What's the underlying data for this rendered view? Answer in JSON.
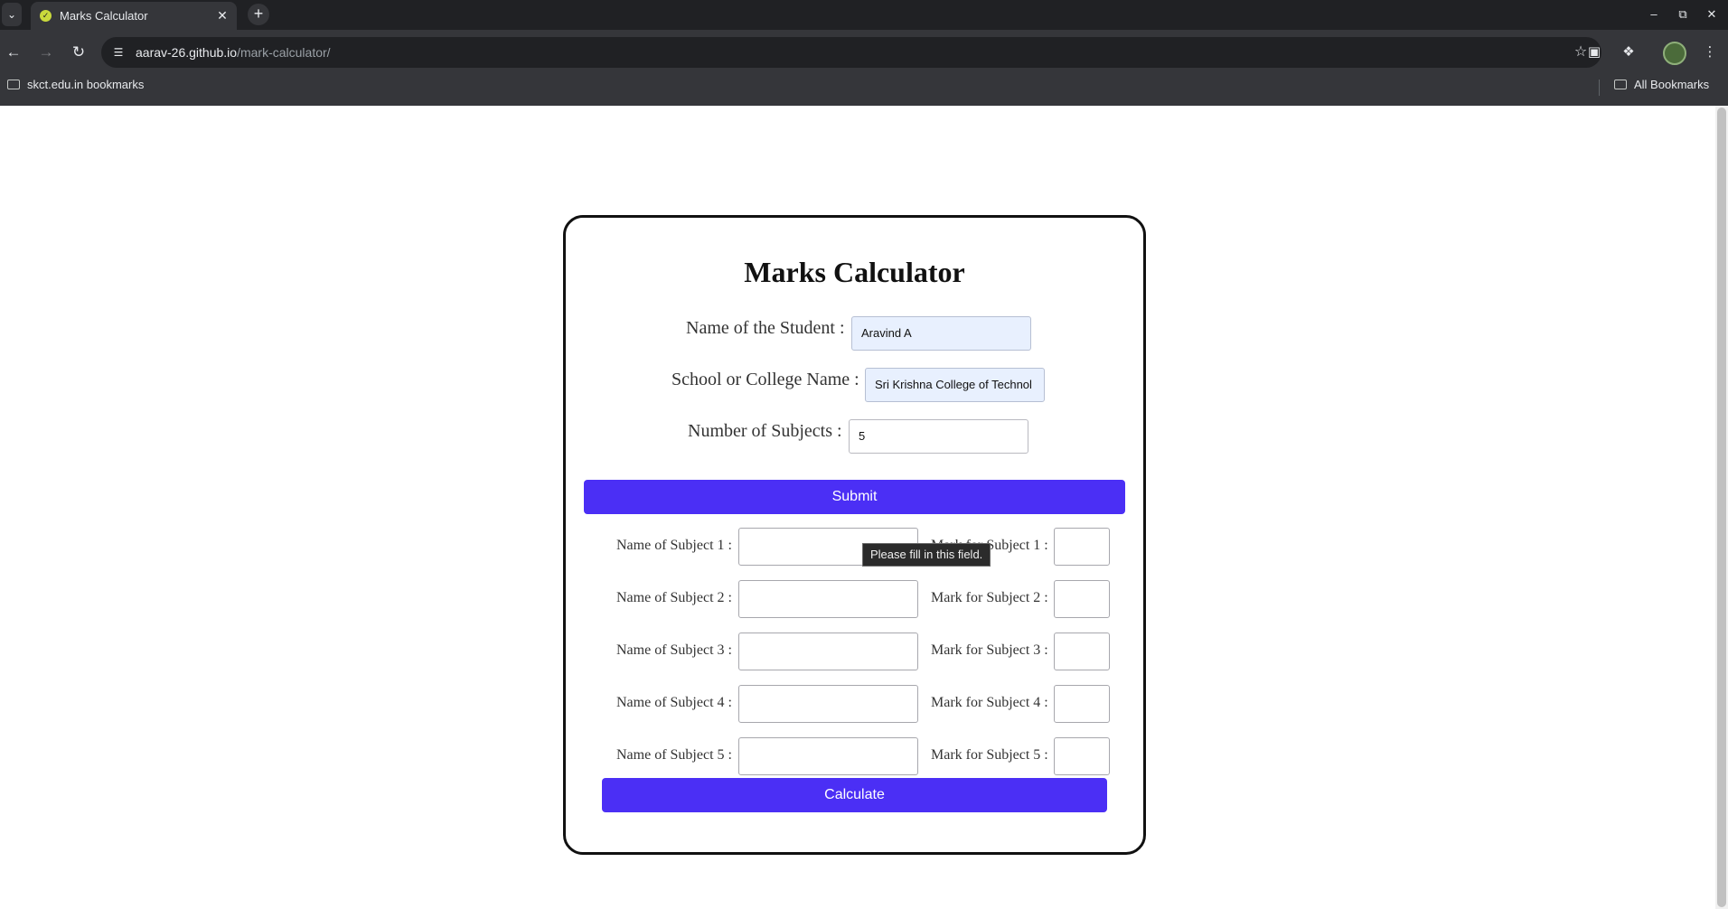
{
  "browser": {
    "tab_title": "Marks Calculator",
    "url_host": "aarav-26.github.io",
    "url_path": "/mark-calculator/",
    "bookmarks": [
      {
        "label": "skct.edu.in bookmarks"
      },
      {
        "label": "All Bookmarks"
      }
    ],
    "icons": [
      "tab-list-icon",
      "close-icon",
      "plus-icon",
      "minimize-icon",
      "restore-icon",
      "back-icon",
      "forward-icon",
      "reload-icon",
      "site-info-icon",
      "star-icon",
      "camera-icon",
      "extensions-icon",
      "kebab-menu-icon",
      "folder-icon"
    ]
  },
  "form": {
    "title": "Marks Calculator",
    "student_label": "Name of the Student :",
    "student_value": "Aravind A",
    "school_label": "School or College Name :",
    "school_value": "Sri Krishna College of Technol",
    "subjects_label": "Number of Subjects :",
    "subjects_value": "5",
    "submit_label": "Submit",
    "calculate_label": "Calculate",
    "subjects": [
      {
        "name_label": "Name of Subject 1 :",
        "mark_label": "Mark for Subject 1 :"
      },
      {
        "name_label": "Name of Subject 2 :",
        "mark_label": "Mark for Subject 2 :"
      },
      {
        "name_label": "Name of Subject 3 :",
        "mark_label": "Mark for Subject 3 :"
      },
      {
        "name_label": "Name of Subject 4 :",
        "mark_label": "Mark for Subject 4 :"
      },
      {
        "name_label": "Name of Subject 5 :",
        "mark_label": "Mark for Subject 5 :"
      }
    ]
  },
  "tooltip": "Please fill in this field.",
  "colors": {
    "accent": "#4b2ff5",
    "autofill": "#e8f0fe",
    "chrome": "#35363a"
  }
}
